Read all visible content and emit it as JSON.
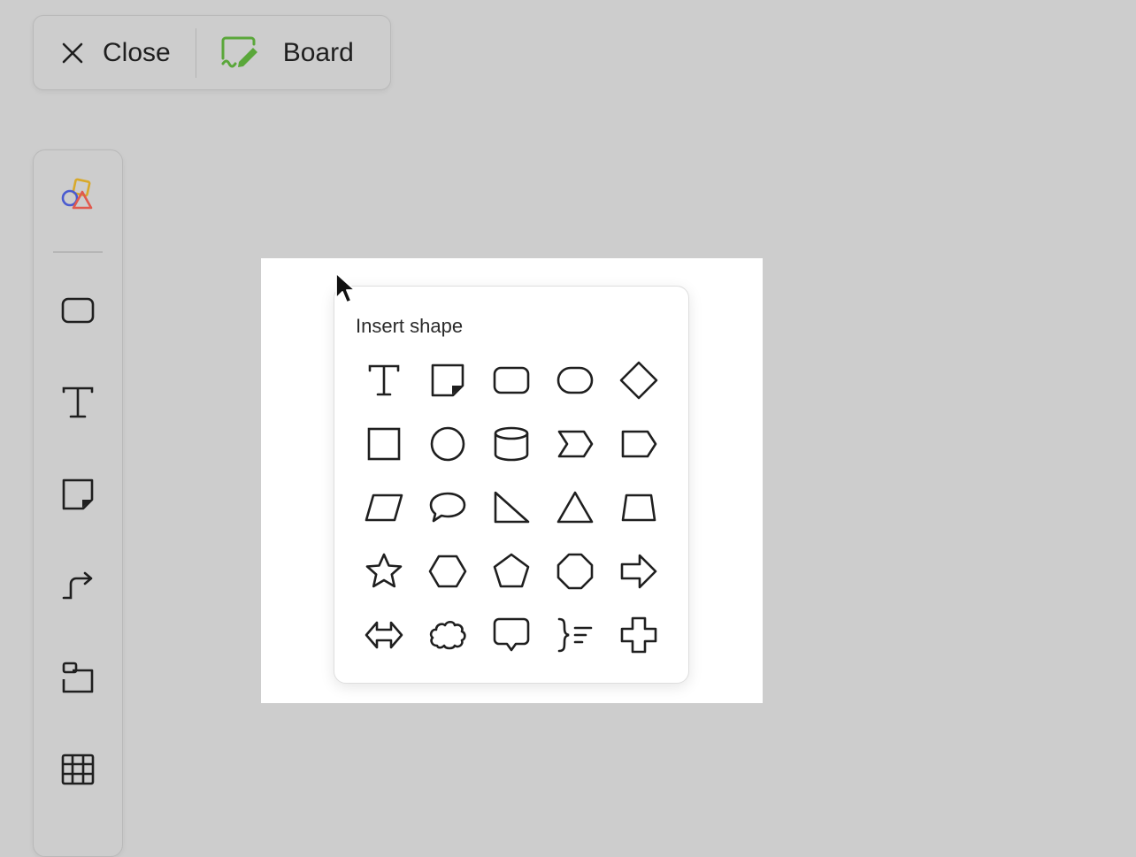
{
  "topbar": {
    "close_label": "Close",
    "board_label": "Board"
  },
  "colors": {
    "board_green": "#5aa73a",
    "shape_blue": "#4a5bd0",
    "shape_yellow": "#d8a92a",
    "shape_red": "#e05a4e",
    "icon_stroke": "#1f1f1f"
  },
  "sidebar": {
    "items": [
      {
        "name": "shapes-icon"
      },
      {
        "name": "rectangle-icon"
      },
      {
        "name": "text-icon"
      },
      {
        "name": "sticky-note-icon"
      },
      {
        "name": "connector-icon"
      },
      {
        "name": "frame-icon"
      },
      {
        "name": "table-icon"
      }
    ]
  },
  "popup": {
    "title": "Insert shape",
    "shapes": [
      "text",
      "sticky-note",
      "rounded-rectangle",
      "stadium",
      "diamond",
      "square",
      "circle",
      "cylinder",
      "chevron",
      "pentagon-tag",
      "parallelogram",
      "speech-bubble",
      "right-triangle",
      "triangle",
      "trapezoid",
      "star",
      "hexagon",
      "pentagon",
      "octagon",
      "arrow-right",
      "double-arrow",
      "cloud",
      "callout",
      "brace-list",
      "cross"
    ]
  }
}
